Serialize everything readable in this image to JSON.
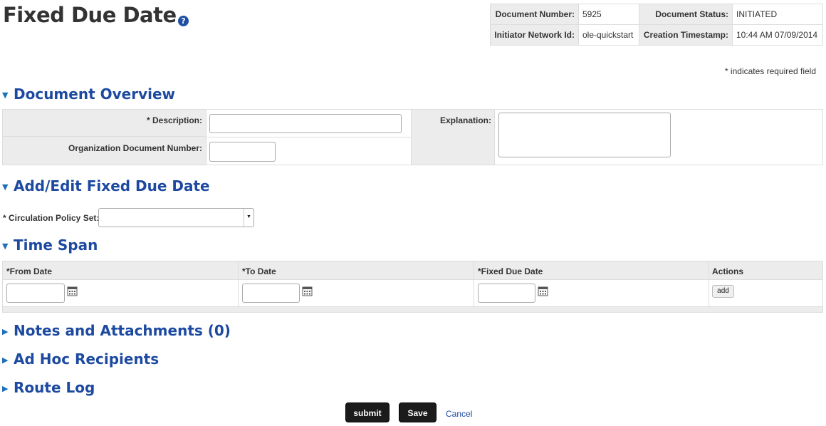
{
  "page": {
    "title": "Fixed Due Date",
    "help_icon": "?"
  },
  "doc_info": {
    "document_number_label": "Document Number:",
    "document_number": "5925",
    "document_status_label": "Document Status:",
    "document_status": "INITIATED",
    "initiator_label": "Initiator Network Id:",
    "initiator": "ole-quickstart",
    "creation_timestamp_label": "Creation Timestamp:",
    "creation_timestamp": "10:44 AM 07/09/2014"
  },
  "required_note": "* indicates required field",
  "document_overview": {
    "title": "Document Overview",
    "description_label": "* Description:",
    "description_value": "",
    "org_doc_number_label": "Organization Document Number:",
    "org_doc_number_value": "",
    "explanation_label": "Explanation:",
    "explanation_value": ""
  },
  "add_edit": {
    "title": "Add/Edit Fixed Due Date",
    "circ_policy_label": "* Circulation Policy Set:",
    "circ_policy_value": ""
  },
  "time_span": {
    "title": "Time Span",
    "columns": [
      "*From Date",
      "*To Date",
      "*Fixed Due Date",
      "Actions"
    ],
    "add_label": "add"
  },
  "collapsed_sections": {
    "notes": "Notes and Attachments (0)",
    "adhoc": "Ad Hoc Recipients",
    "route_log": "Route Log"
  },
  "buttons": {
    "submit": "submit",
    "save": "Save",
    "cancel": "Cancel"
  },
  "icons": {
    "expanded_toggle": "triangle-down-icon",
    "collapsed_toggle": "triangle-right-icon",
    "calendar": "calendar-icon",
    "help": "help-icon"
  },
  "colors": {
    "section_title": "#1d4aa0",
    "header_bg": "#ececec",
    "dark_button": "#1b1b1b"
  }
}
